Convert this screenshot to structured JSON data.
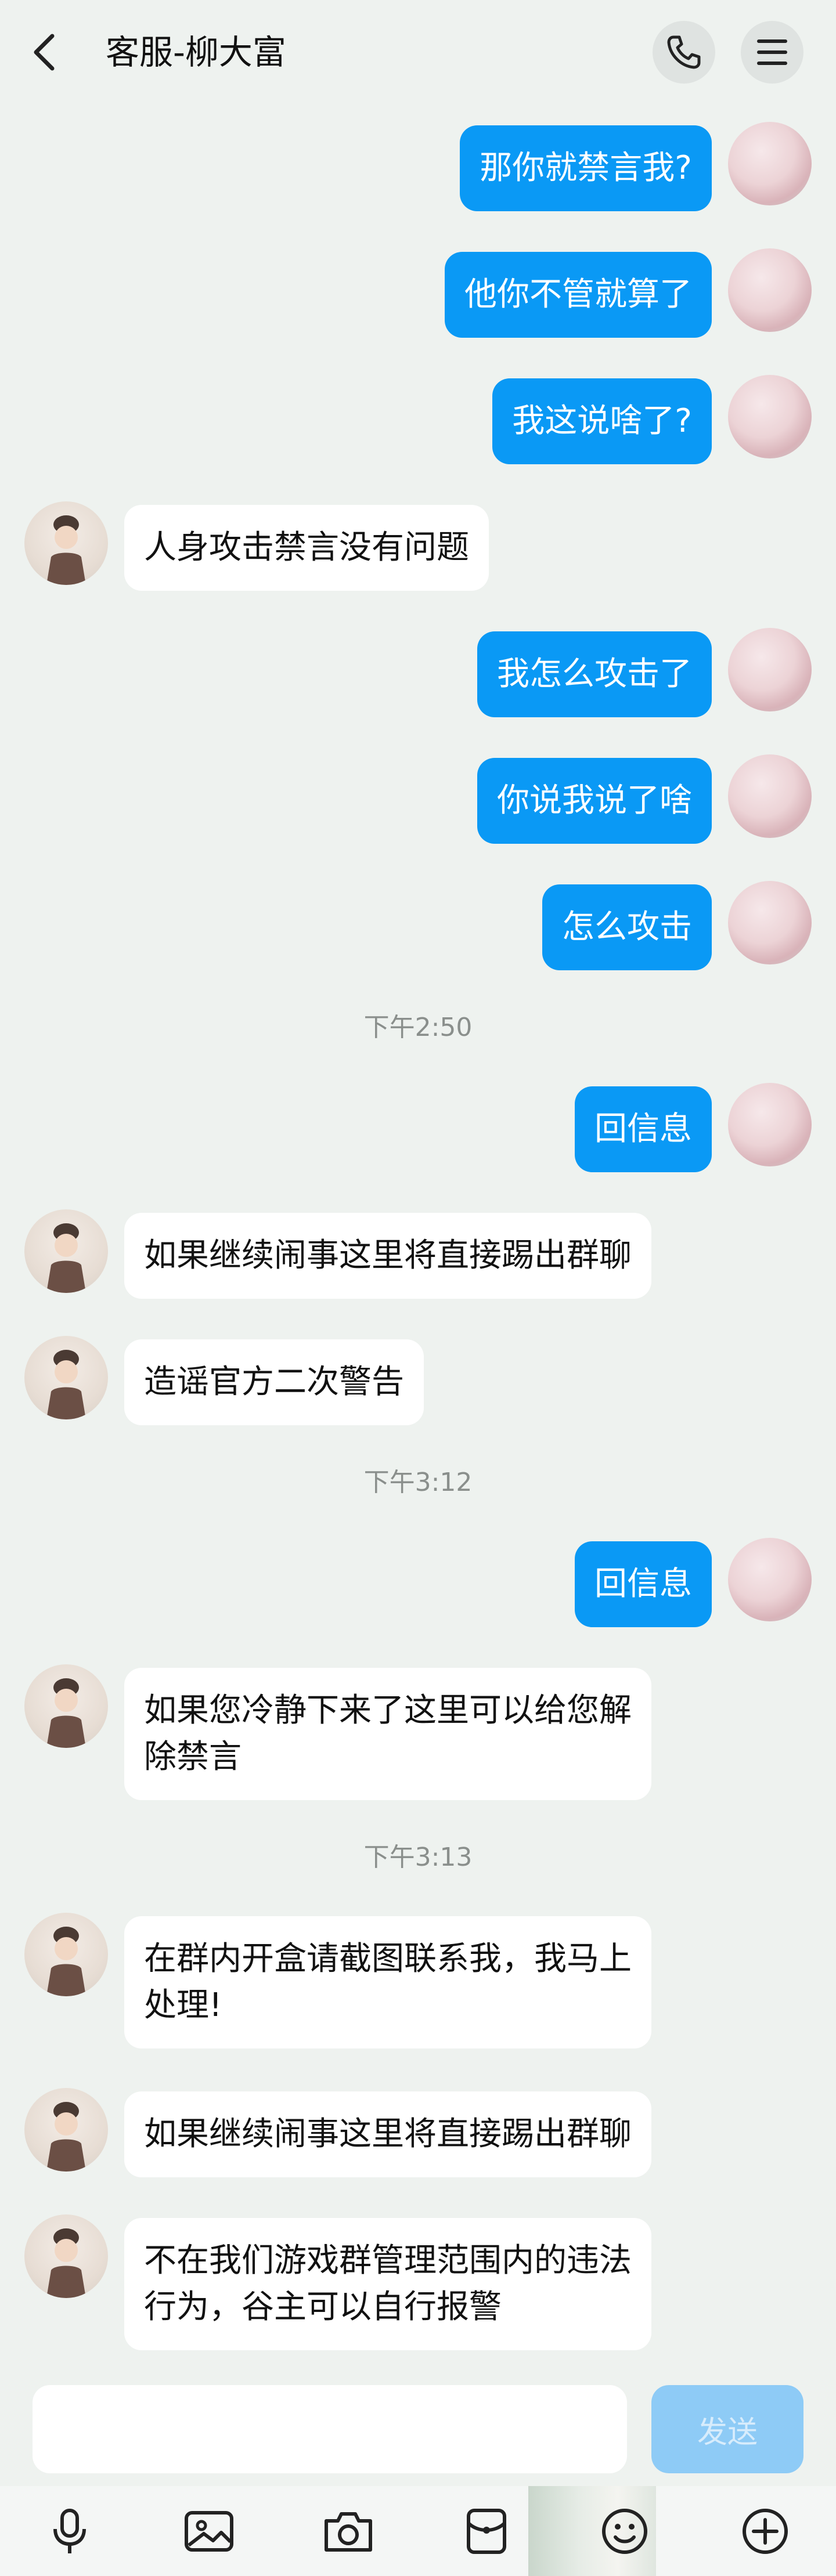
{
  "header": {
    "title": "客服-柳大富"
  },
  "messages": [
    {
      "side": "me",
      "text": "那你就禁言我?"
    },
    {
      "side": "me",
      "text": "他你不管就算了"
    },
    {
      "side": "me",
      "text": "我这说啥了?"
    },
    {
      "side": "agent",
      "text": "人身攻击禁言没有问题"
    },
    {
      "side": "me",
      "text": "我怎么攻击了"
    },
    {
      "side": "me",
      "text": "你说我说了啥"
    },
    {
      "side": "me",
      "text": "怎么攻击"
    },
    {
      "time": "下午2:50"
    },
    {
      "side": "me",
      "text": "回信息"
    },
    {
      "side": "agent",
      "text": "如果继续闹事这里将直接踢出群聊"
    },
    {
      "side": "agent",
      "text": "造谣官方二次警告"
    },
    {
      "time": "下午3:12"
    },
    {
      "side": "me",
      "text": "回信息"
    },
    {
      "side": "agent",
      "text": "如果您冷静下来了这里可以给您解\n除禁言"
    },
    {
      "time": "下午3:13"
    },
    {
      "side": "agent",
      "text": "在群内开盒请截图联系我，我马上\n处理!"
    },
    {
      "side": "agent",
      "text": "如果继续闹事这里将直接踢出群聊"
    },
    {
      "side": "agent",
      "text": "不在我们游戏群管理范围内的违法\n行为，谷主可以自行报警"
    }
  ],
  "input": {
    "placeholder": "",
    "send_label": "发送"
  },
  "toolbar": {
    "icons": [
      "microphone-icon",
      "image-icon",
      "camera-icon",
      "red-packet-icon",
      "emoji-icon",
      "plus-icon"
    ]
  },
  "colors": {
    "background": "#eef2ef",
    "my_bubble": "#0a99f5",
    "agent_bubble": "#ffffff",
    "send_button": "#8ecbf6"
  }
}
